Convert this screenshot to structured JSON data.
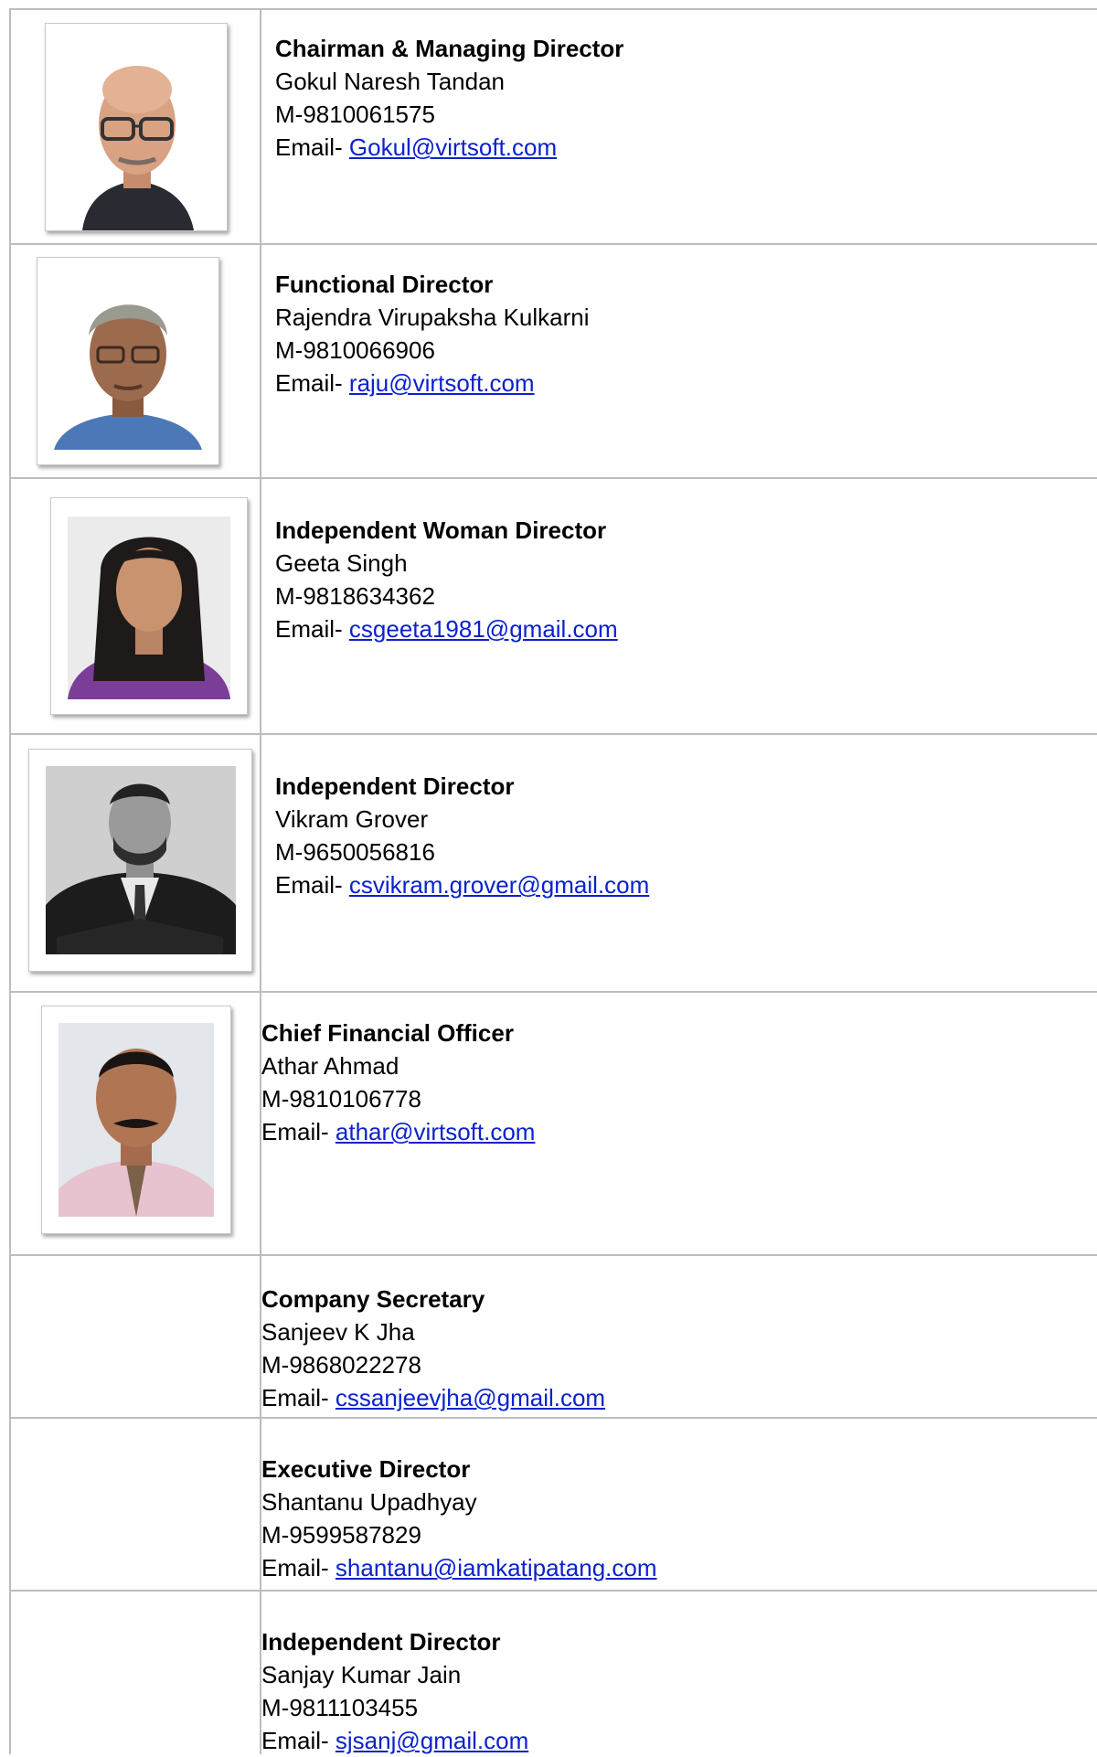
{
  "members": [
    {
      "title": "Chairman & Managing Director",
      "name": "Gokul Naresh Tandan",
      "mobile": "M-9810061575",
      "email_label": "Email-",
      "email": "Gokul@virtsoft.com"
    },
    {
      "title": "Functional Director",
      "name": "Rajendra Virupaksha Kulkarni",
      "mobile": "M-9810066906",
      "email_label": "Email-",
      "email": "raju@virtsoft.com"
    },
    {
      "title": "Independent Woman Director",
      "name": "Geeta Singh",
      "mobile": "M-9818634362",
      "email_label": "Email-",
      "email": "csgeeta1981@gmail.com"
    },
    {
      "title": "Independent Director",
      "name": "Vikram Grover",
      "mobile": "M-9650056816",
      "email_label": "Email-",
      "email": "csvikram.grover@gmail.com"
    },
    {
      "title": "Chief Financial Officer",
      "name": "Athar Ahmad",
      "mobile": "M-9810106778",
      "email_label": "Email-",
      "email": "athar@virtsoft.com"
    },
    {
      "title": "Company Secretary",
      "name": "Sanjeev K Jha",
      "mobile": "M-9868022278",
      "email_label": "Email-",
      "email": "cssanjeevjha@gmail.com"
    },
    {
      "title": "Executive Director",
      "name": "Shantanu Upadhyay",
      "mobile": "M-9599587829",
      "email_label": "Email-",
      "email": "shantanu@iamkatipatang.com"
    },
    {
      "title": "Independent Director",
      "name": "Sanjay Kumar Jain",
      "mobile": "M-9811103455",
      "email_label": "Email-",
      "email": "sjsanj@gmail.com"
    }
  ]
}
